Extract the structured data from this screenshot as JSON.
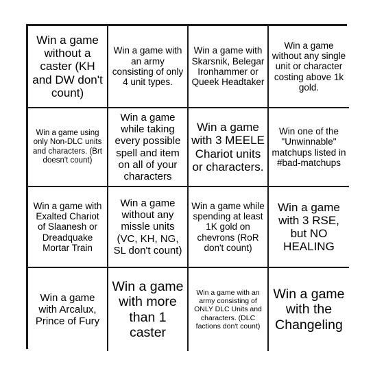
{
  "card": {
    "type": "bingo",
    "columns": 4,
    "rows": 4,
    "border_color": "#1b1b1b",
    "cell_background": "#ffffff",
    "text_color": "#000000",
    "page_background": "#ffffff",
    "cells": [
      {
        "row": 1,
        "col": 1,
        "size": "lg",
        "text": "Win a game without a caster (KH and DW don't count)"
      },
      {
        "row": 1,
        "col": 2,
        "size": "sm",
        "text": "Win a game with an army consisting of only 4 unit types."
      },
      {
        "row": 1,
        "col": 3,
        "size": "sm",
        "text": "Win a game with Skarsnik, Belegar Ironhammer or Queek Headtaker"
      },
      {
        "row": 1,
        "col": 4,
        "size": "sm",
        "text": "Win a game without any single unit or character costing above 1k gold."
      },
      {
        "row": 2,
        "col": 1,
        "size": "xs",
        "text": "Win a game using only Non-DLC units and characters. (Brt doesn't count)"
      },
      {
        "row": 2,
        "col": 2,
        "size": "md",
        "text": "Win a game while taking every possible spell and item on all of your characters"
      },
      {
        "row": 2,
        "col": 3,
        "size": "lg",
        "text": "Win a game with 3 MEELE Chariot units or characters."
      },
      {
        "row": 2,
        "col": 4,
        "size": "sm",
        "text": "Win one of the \"Unwinnable\" matchups listed in #bad-matchups"
      },
      {
        "row": 3,
        "col": 1,
        "size": "sm",
        "text": "Win a game with Exalted Chariot of Slaanesh or Dreadquake Mortar Train"
      },
      {
        "row": 3,
        "col": 2,
        "size": "md",
        "text": "Win a game without any missle units (VC, KH, NG, SL don't count)"
      },
      {
        "row": 3,
        "col": 3,
        "size": "sm",
        "text": "Win a game while spending at least 1K gold on chevrons (RoR don't count)"
      },
      {
        "row": 3,
        "col": 4,
        "size": "lg",
        "text": "Win a game with 3 RSE, but NO HEALING"
      },
      {
        "row": 4,
        "col": 1,
        "size": "md",
        "text": "Win a game with Arcalux, Prince of Fury"
      },
      {
        "row": 4,
        "col": 2,
        "size": "xl",
        "text": "Win a game with more than 1 caster"
      },
      {
        "row": 4,
        "col": 3,
        "size": "xxs",
        "text": "Win a game with an army consisting of ONLY DLC Units and characters. (DLC factions don't count)"
      },
      {
        "row": 4,
        "col": 4,
        "size": "xl",
        "text": "Win a game with the Changeling"
      }
    ]
  }
}
